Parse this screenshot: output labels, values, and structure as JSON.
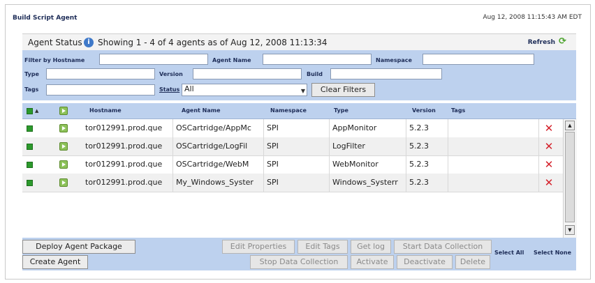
{
  "header": {
    "title": "Build Script Agent",
    "timestamp": "Aug 12, 2008 11:15:43 AM EDT"
  },
  "status_bar": {
    "label": "Agent Status",
    "summary": "Showing 1 - 4  of 4 agents as of Aug 12, 2008 11:13:34",
    "refresh_label": "Refresh"
  },
  "filters": {
    "hostname_label": "Filter by Hostname",
    "hostname_value": "",
    "agent_name_label": "Agent Name",
    "agent_name_value": "",
    "namespace_label": "Namespace",
    "namespace_value": "",
    "type_label": "Type",
    "type_value": "",
    "version_label": "Version",
    "version_value": "",
    "build_label": "Build",
    "build_value": "",
    "tags_label": "Tags",
    "tags_value": "",
    "status_label": "Status",
    "status_value": "All",
    "clear_label": "Clear Filters"
  },
  "table": {
    "columns": [
      "Hostname",
      "Agent Name",
      "Namespace",
      "Type",
      "Version",
      "Tags"
    ],
    "rows": [
      {
        "hostname": "tor012991.prod.que",
        "agent_name": "OSCartridge/AppMc",
        "namespace": "SPI",
        "type": "AppMonitor",
        "version": "5.2.3",
        "tags": ""
      },
      {
        "hostname": "tor012991.prod.que",
        "agent_name": "OSCartridge/LogFil",
        "namespace": "SPI",
        "type": "LogFilter",
        "version": "5.2.3",
        "tags": ""
      },
      {
        "hostname": "tor012991.prod.que",
        "agent_name": "OSCartridge/WebM",
        "namespace": "SPI",
        "type": "WebMonitor",
        "version": "5.2.3",
        "tags": ""
      },
      {
        "hostname": "tor012991.prod.que",
        "agent_name": "My_Windows_Syster",
        "namespace": "SPI",
        "type": "Windows_Systerr",
        "version": "5.2.3",
        "tags": ""
      }
    ]
  },
  "actions": {
    "deploy": "Deploy Agent Package",
    "create": "Create Agent",
    "edit_properties": "Edit Properties",
    "edit_tags": "Edit Tags",
    "get_log": "Get log",
    "start_collection": "Start Data Collection",
    "stop_collection": "Stop Data Collection",
    "activate": "Activate",
    "deactivate": "Deactivate",
    "delete": "Delete",
    "select_all": "Select All",
    "select_none": "Select None"
  },
  "colors": {
    "panel_blue": "#bdd1ee",
    "status_green": "#2c9a2c",
    "delete_red": "#d4202a"
  },
  "icons": {
    "info": "info-icon",
    "refresh": "refresh-icon",
    "status": "green-status-icon",
    "play": "play-icon",
    "delete": "delete-x-icon"
  }
}
